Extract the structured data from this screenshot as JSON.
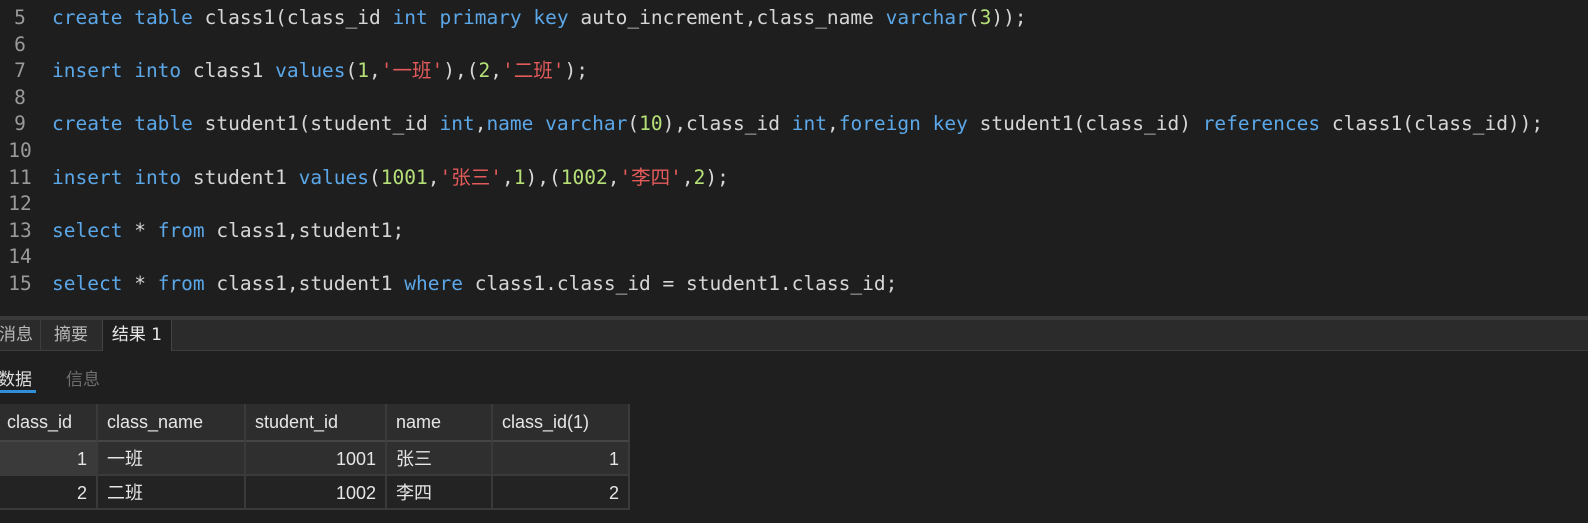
{
  "editor": {
    "lines": [
      {
        "n": "5",
        "tokens": [
          [
            "kw",
            "create"
          ],
          [
            "id",
            " "
          ],
          [
            "kw",
            "table"
          ],
          [
            "id",
            " class1(class_id "
          ],
          [
            "kw",
            "int"
          ],
          [
            "id",
            " "
          ],
          [
            "kw",
            "primary"
          ],
          [
            "id",
            " "
          ],
          [
            "kw",
            "key"
          ],
          [
            "id",
            " auto_increment,class_name "
          ],
          [
            "kw",
            "varchar"
          ],
          [
            "id",
            "("
          ],
          [
            "num",
            "3"
          ],
          [
            "id",
            "));"
          ]
        ]
      },
      {
        "n": "6",
        "tokens": []
      },
      {
        "n": "7",
        "tokens": [
          [
            "kw",
            "insert"
          ],
          [
            "id",
            " "
          ],
          [
            "kw",
            "into"
          ],
          [
            "id",
            " class1 "
          ],
          [
            "kw",
            "values"
          ],
          [
            "id",
            "("
          ],
          [
            "num",
            "1"
          ],
          [
            "id",
            ","
          ],
          [
            "str",
            "'一班'"
          ],
          [
            "id",
            "),("
          ],
          [
            "num",
            "2"
          ],
          [
            "id",
            ","
          ],
          [
            "str",
            "'二班'"
          ],
          [
            "id",
            ");"
          ]
        ]
      },
      {
        "n": "8",
        "tokens": []
      },
      {
        "n": "9",
        "tokens": [
          [
            "kw",
            "create"
          ],
          [
            "id",
            " "
          ],
          [
            "kw",
            "table"
          ],
          [
            "id",
            " student1(student_id "
          ],
          [
            "kw",
            "int"
          ],
          [
            "id",
            ","
          ],
          [
            "kw",
            "name"
          ],
          [
            "id",
            " "
          ],
          [
            "kw",
            "varchar"
          ],
          [
            "id",
            "("
          ],
          [
            "num",
            "10"
          ],
          [
            "id",
            "),class_id "
          ],
          [
            "kw",
            "int"
          ],
          [
            "id",
            ","
          ],
          [
            "kw",
            "foreign"
          ],
          [
            "id",
            " "
          ],
          [
            "kw",
            "key"
          ],
          [
            "id",
            " student1(class_id) "
          ],
          [
            "kw",
            "references"
          ],
          [
            "id",
            " class1(class_id));"
          ]
        ]
      },
      {
        "n": "10",
        "tokens": []
      },
      {
        "n": "11",
        "tokens": [
          [
            "kw",
            "insert"
          ],
          [
            "id",
            " "
          ],
          [
            "kw",
            "into"
          ],
          [
            "id",
            " student1 "
          ],
          [
            "kw",
            "values"
          ],
          [
            "id",
            "("
          ],
          [
            "num",
            "1001"
          ],
          [
            "id",
            ","
          ],
          [
            "str",
            "'张三'"
          ],
          [
            "id",
            ","
          ],
          [
            "num",
            "1"
          ],
          [
            "id",
            "),("
          ],
          [
            "num",
            "1002"
          ],
          [
            "id",
            ","
          ],
          [
            "str",
            "'李四'"
          ],
          [
            "id",
            ","
          ],
          [
            "num",
            "2"
          ],
          [
            "id",
            ");"
          ]
        ]
      },
      {
        "n": "12",
        "tokens": []
      },
      {
        "n": "13",
        "tokens": [
          [
            "kw",
            "select"
          ],
          [
            "id",
            " * "
          ],
          [
            "kw",
            "from"
          ],
          [
            "id",
            " class1,student1;"
          ]
        ]
      },
      {
        "n": "14",
        "tokens": []
      },
      {
        "n": "15",
        "tokens": [
          [
            "kw",
            "select"
          ],
          [
            "id",
            " * "
          ],
          [
            "kw",
            "from"
          ],
          [
            "id",
            " class1,student1 "
          ],
          [
            "kw",
            "where"
          ],
          [
            "id",
            " class1.class_id = student1.class_id;"
          ]
        ]
      }
    ]
  },
  "result_tabs": [
    {
      "label": "消息",
      "active": false
    },
    {
      "label": "摘要",
      "active": false
    },
    {
      "label": "结果 1",
      "active": true
    }
  ],
  "sub_tabs": [
    {
      "label": "数据",
      "active": true
    },
    {
      "label": "信息",
      "active": false
    }
  ],
  "grid": {
    "columns": [
      "class_id",
      "class_name",
      "student_id",
      "name",
      "class_id(1)"
    ],
    "rows": [
      [
        "1",
        "一班",
        "1001",
        "张三",
        "1"
      ],
      [
        "2",
        "二班",
        "1002",
        "李四",
        "2"
      ]
    ],
    "numeric_columns": [
      0,
      2,
      4
    ]
  },
  "colors": {
    "keyword": "#5ba7e8",
    "number": "#b5e078",
    "string": "#e35a5a",
    "identifier": "#d6d6d6",
    "accent": "#2f8fd8"
  }
}
